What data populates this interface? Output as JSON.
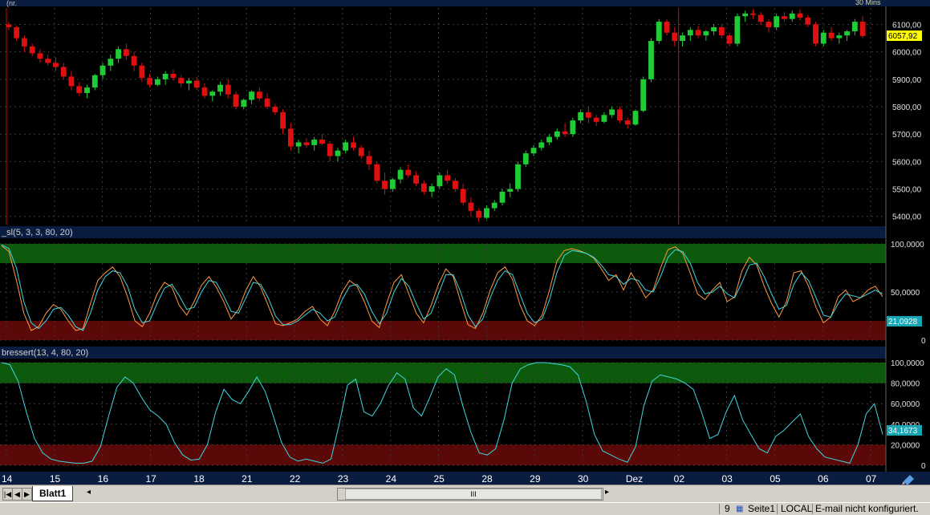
{
  "panels": {
    "price": {
      "title_suffix": "(nr.",
      "top_right_label": "30 Mins",
      "y_ticks": [
        "6100,00",
        "6000,00",
        "5900,00",
        "5800,00",
        "5700,00",
        "5600,00",
        "5500,00",
        "5400,00"
      ],
      "current_value": "6057,92"
    },
    "stoch": {
      "title": "_sl(5, 3, 3, 80, 20)",
      "y_ticks": [
        "100,0000",
        "50,0000",
        "0"
      ],
      "current_value": "21,0928"
    },
    "bressert": {
      "title": "bressert(13, 4, 80, 20)",
      "y_ticks": [
        "100,0000",
        "80,0000",
        "60,0000",
        "40,0000",
        "20,0000",
        "0"
      ],
      "current_value": "34,1673"
    }
  },
  "x_axis": {
    "labels": [
      "14",
      "15",
      "16",
      "17",
      "18",
      "21",
      "22",
      "23",
      "24",
      "25",
      "28",
      "29",
      "30",
      "Dez",
      "02",
      "03",
      "05",
      "06",
      "07"
    ]
  },
  "sheet": {
    "tab": "Blatt1",
    "scroll_thumb": "III"
  },
  "status": {
    "page_num": "9",
    "page": "Seite1",
    "mode": "LOCAL",
    "email": "E-mail nicht konfiguriert."
  },
  "colors": {
    "up": "#1fcc35",
    "down": "#e01010",
    "stoch_k": "#ff9a40",
    "stoch_d": "#3fd7e0",
    "bressert": "#3fd7e0",
    "overbought": "#0d5a0d",
    "oversold": "#5a0808",
    "panel_header": "#0a1c40",
    "axis_label_bg": "#ffff00",
    "current_tag_bg": "#18a6b4"
  },
  "chart_data": [
    {
      "type": "candlestick",
      "title": "",
      "ylim": [
        5370,
        6160
      ],
      "x": [
        "14",
        "15",
        "16",
        "17",
        "18",
        "21",
        "22",
        "23",
        "24",
        "25",
        "28",
        "29",
        "30",
        "Dez",
        "02",
        "03",
        "05",
        "06",
        "07"
      ],
      "candles": [
        [
          6100,
          6110,
          6080,
          6090
        ],
        [
          6090,
          6095,
          6040,
          6050
        ],
        [
          6050,
          6060,
          6000,
          6020
        ],
        [
          6020,
          6030,
          5985,
          5995
        ],
        [
          5995,
          6010,
          5960,
          5975
        ],
        [
          5975,
          5990,
          5950,
          5960
        ],
        [
          5960,
          5980,
          5930,
          5945
        ],
        [
          5945,
          5960,
          5900,
          5910
        ],
        [
          5910,
          5930,
          5860,
          5875
        ],
        [
          5875,
          5890,
          5840,
          5850
        ],
        [
          5850,
          5880,
          5830,
          5870
        ],
        [
          5870,
          5920,
          5860,
          5915
        ],
        [
          5915,
          5960,
          5900,
          5950
        ],
        [
          5950,
          5990,
          5930,
          5975
        ],
        [
          5975,
          6020,
          5960,
          6010
        ],
        [
          6010,
          6030,
          5970,
          5985
        ],
        [
          5985,
          6000,
          5930,
          5950
        ],
        [
          5950,
          5960,
          5890,
          5905
        ],
        [
          5905,
          5920,
          5870,
          5880
        ],
        [
          5880,
          5910,
          5875,
          5900
        ],
        [
          5900,
          5930,
          5880,
          5920
        ],
        [
          5920,
          5935,
          5895,
          5905
        ],
        [
          5905,
          5915,
          5870,
          5885
        ],
        [
          5885,
          5905,
          5860,
          5895
        ],
        [
          5895,
          5910,
          5860,
          5870
        ],
        [
          5870,
          5885,
          5830,
          5840
        ],
        [
          5840,
          5860,
          5820,
          5855
        ],
        [
          5855,
          5890,
          5840,
          5880
        ],
        [
          5880,
          5900,
          5830,
          5845
        ],
        [
          5845,
          5855,
          5790,
          5800
        ],
        [
          5800,
          5830,
          5790,
          5825
        ],
        [
          5825,
          5860,
          5810,
          5855
        ],
        [
          5855,
          5870,
          5820,
          5830
        ],
        [
          5830,
          5850,
          5790,
          5800
        ],
        [
          5800,
          5810,
          5770,
          5780
        ],
        [
          5780,
          5790,
          5700,
          5720
        ],
        [
          5720,
          5740,
          5640,
          5655
        ],
        [
          5655,
          5680,
          5630,
          5670
        ],
        [
          5670,
          5685,
          5650,
          5660
        ],
        [
          5660,
          5690,
          5640,
          5680
        ],
        [
          5680,
          5700,
          5660,
          5665
        ],
        [
          5665,
          5675,
          5600,
          5620
        ],
        [
          5620,
          5650,
          5600,
          5640
        ],
        [
          5640,
          5680,
          5630,
          5670
        ],
        [
          5670,
          5690,
          5640,
          5650
        ],
        [
          5650,
          5660,
          5610,
          5620
        ],
        [
          5620,
          5640,
          5570,
          5590
        ],
        [
          5590,
          5600,
          5520,
          5530
        ],
        [
          5530,
          5560,
          5480,
          5500
        ],
        [
          5500,
          5540,
          5490,
          5535
        ],
        [
          5535,
          5580,
          5520,
          5570
        ],
        [
          5570,
          5590,
          5540,
          5550
        ],
        [
          5550,
          5565,
          5510,
          5520
        ],
        [
          5520,
          5530,
          5480,
          5490
        ],
        [
          5490,
          5520,
          5470,
          5510
        ],
        [
          5510,
          5560,
          5500,
          5550
        ],
        [
          5550,
          5570,
          5520,
          5530
        ],
        [
          5530,
          5540,
          5490,
          5500
        ],
        [
          5500,
          5520,
          5440,
          5450
        ],
        [
          5450,
          5470,
          5400,
          5420
        ],
        [
          5420,
          5430,
          5380,
          5395
        ],
        [
          5395,
          5440,
          5390,
          5430
        ],
        [
          5430,
          5460,
          5420,
          5450
        ],
        [
          5450,
          5500,
          5440,
          5490
        ],
        [
          5490,
          5520,
          5470,
          5500
        ],
        [
          5500,
          5600,
          5490,
          5590
        ],
        [
          5590,
          5640,
          5580,
          5630
        ],
        [
          5630,
          5660,
          5620,
          5650
        ],
        [
          5650,
          5680,
          5640,
          5670
        ],
        [
          5670,
          5700,
          5660,
          5690
        ],
        [
          5690,
          5720,
          5680,
          5710
        ],
        [
          5710,
          5740,
          5690,
          5700
        ],
        [
          5700,
          5760,
          5690,
          5750
        ],
        [
          5750,
          5790,
          5740,
          5780
        ],
        [
          5780,
          5800,
          5740,
          5760
        ],
        [
          5760,
          5770,
          5730,
          5745
        ],
        [
          5745,
          5780,
          5740,
          5770
        ],
        [
          5770,
          5800,
          5760,
          5790
        ],
        [
          5790,
          5800,
          5740,
          5750
        ],
        [
          5750,
          5760,
          5720,
          5735
        ],
        [
          5735,
          5790,
          5730,
          5785
        ],
        [
          5785,
          5910,
          5780,
          5900
        ],
        [
          5900,
          6050,
          5890,
          6040
        ],
        [
          6040,
          6120,
          6030,
          6110
        ],
        [
          6110,
          6120,
          6060,
          6070
        ],
        [
          6070,
          6090,
          6020,
          6040
        ],
        [
          6040,
          6070,
          6020,
          6060
        ],
        [
          6060,
          6090,
          6040,
          6080
        ],
        [
          6080,
          6095,
          6050,
          6060
        ],
        [
          6060,
          6080,
          6040,
          6075
        ],
        [
          6075,
          6100,
          6060,
          6090
        ],
        [
          6090,
          6100,
          6050,
          6060
        ],
        [
          6060,
          6070,
          6020,
          6030
        ],
        [
          6030,
          6140,
          6020,
          6130
        ],
        [
          6130,
          6150,
          6110,
          6140
        ],
        [
          6140,
          6155,
          6120,
          6135
        ],
        [
          6135,
          6145,
          6100,
          6110
        ],
        [
          6110,
          6120,
          6070,
          6090
        ],
        [
          6090,
          6140,
          6080,
          6130
        ],
        [
          6130,
          6145,
          6110,
          6120
        ],
        [
          6120,
          6150,
          6110,
          6140
        ],
        [
          6140,
          6155,
          6115,
          6125
        ],
        [
          6125,
          6135,
          6090,
          6100
        ],
        [
          6100,
          6110,
          6020,
          6030
        ],
        [
          6030,
          6080,
          6020,
          6070
        ],
        [
          6070,
          6090,
          6040,
          6050
        ],
        [
          6050,
          6070,
          6030,
          6060
        ],
        [
          6060,
          6080,
          6040,
          6075
        ],
        [
          6075,
          6120,
          6060,
          6110
        ],
        [
          6110,
          6130,
          6050,
          6058
        ]
      ]
    },
    {
      "type": "line",
      "title": "_sl(5, 3, 3, 80, 20)",
      "ylim": [
        0,
        100
      ],
      "bands": {
        "overbought": [
          80,
          100
        ],
        "oversold": [
          0,
          20
        ]
      },
      "series": [
        {
          "values": [
            98,
            92,
            62,
            28,
            10,
            14,
            28,
            37,
            32,
            20,
            10,
            12,
            38,
            62,
            70,
            76,
            66,
            45,
            20,
            14,
            28,
            48,
            60,
            55,
            36,
            26,
            40,
            57,
            66,
            55,
            40,
            22,
            32,
            52,
            66,
            55,
            36,
            17,
            15,
            18,
            22,
            30,
            35,
            22,
            15,
            30,
            50,
            62,
            56,
            40,
            20,
            13,
            38,
            60,
            68,
            48,
            28,
            18,
            36,
            58,
            74,
            66,
            40,
            16,
            12,
            28,
            52,
            70,
            76,
            63,
            37,
            20,
            15,
            26,
            52,
            82,
            93,
            95,
            93,
            90,
            85,
            74,
            62,
            68,
            52,
            70,
            58,
            44,
            52,
            75,
            94,
            97,
            90,
            70,
            48,
            42,
            52,
            60,
            40,
            45,
            72,
            86,
            78,
            56,
            38,
            24,
            40,
            70,
            72,
            56,
            34,
            18,
            24,
            45,
            52,
            40,
            44,
            52,
            56,
            45
          ]
        },
        {
          "values": [
            99,
            95,
            75,
            40,
            18,
            12,
            20,
            32,
            34,
            26,
            14,
            10,
            28,
            52,
            66,
            72,
            70,
            56,
            32,
            18,
            20,
            38,
            54,
            58,
            46,
            32,
            34,
            50,
            62,
            60,
            46,
            30,
            28,
            44,
            60,
            58,
            44,
            25,
            16,
            16,
            20,
            26,
            32,
            28,
            20,
            24,
            42,
            56,
            58,
            48,
            30,
            17,
            28,
            50,
            64,
            56,
            38,
            22,
            28,
            48,
            68,
            68,
            50,
            26,
            14,
            22,
            44,
            62,
            72,
            68,
            48,
            28,
            18,
            22,
            42,
            70,
            88,
            93,
            92,
            90,
            86,
            78,
            68,
            66,
            58,
            64,
            62,
            52,
            50,
            66,
            86,
            94,
            92,
            80,
            60,
            48,
            50,
            56,
            48,
            44,
            60,
            78,
            80,
            66,
            48,
            32,
            36,
            58,
            70,
            62,
            44,
            26,
            24,
            38,
            48,
            46,
            44,
            48,
            52,
            48
          ]
        }
      ]
    },
    {
      "type": "line",
      "title": "bressert(13, 4, 80, 20)",
      "ylim": [
        0,
        100
      ],
      "bands": {
        "overbought": [
          80,
          100
        ],
        "oversold": [
          0,
          20
        ]
      },
      "series": [
        {
          "values": [
            100,
            98,
            82,
            52,
            26,
            12,
            6,
            4,
            3,
            2,
            2,
            4,
            18,
            48,
            76,
            86,
            80,
            66,
            54,
            48,
            40,
            22,
            10,
            5,
            6,
            20,
            52,
            74,
            64,
            60,
            72,
            86,
            72,
            48,
            22,
            8,
            4,
            6,
            4,
            2,
            6,
            40,
            78,
            84,
            52,
            48,
            60,
            78,
            90,
            84,
            56,
            48,
            66,
            86,
            94,
            88,
            58,
            32,
            12,
            10,
            16,
            44,
            80,
            94,
            98,
            100,
            100,
            99,
            98,
            96,
            88,
            62,
            30,
            14,
            10,
            6,
            3,
            18,
            58,
            82,
            88,
            86,
            84,
            80,
            74,
            52,
            26,
            30,
            52,
            68,
            44,
            30,
            16,
            12,
            28,
            34,
            42,
            50,
            28,
            16,
            8,
            6,
            4,
            2,
            20,
            50,
            60,
            30
          ]
        }
      ]
    }
  ]
}
